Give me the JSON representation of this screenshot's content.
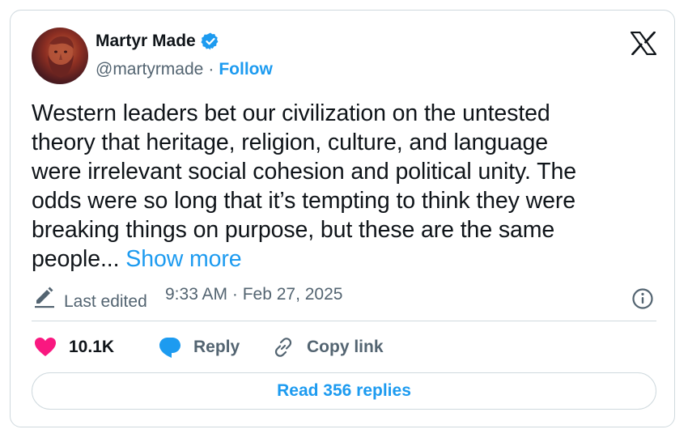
{
  "author": {
    "name": "Martyr Made",
    "handle": "@martyrmade",
    "separator": "·",
    "follow_label": "Follow",
    "verified": true,
    "avatar_icon": "bearded-head-portrait"
  },
  "tweet": {
    "lines": [
      "Western leaders bet our civilization on the untested",
      "theory that heritage, religion, culture, and language",
      "were irrelevant social cohesion and political unity. The",
      "odds were so long that it’s tempting to think they were",
      "breaking things on purpose, but these are the same",
      "people..."
    ],
    "show_more_label": "Show more"
  },
  "meta": {
    "edited_label": "Last edited",
    "timestamp": "9:33 AM · Feb 27, 2025"
  },
  "actions": {
    "likes": "10.1K",
    "reply_label": "Reply",
    "copy_link_label": "Copy link"
  },
  "read_replies_label": "Read 356 replies",
  "colors": {
    "accent": "#1d9bf0",
    "like": "#f91880",
    "text": "#0f1419",
    "muted": "#536471",
    "border": "#cfd9de"
  }
}
